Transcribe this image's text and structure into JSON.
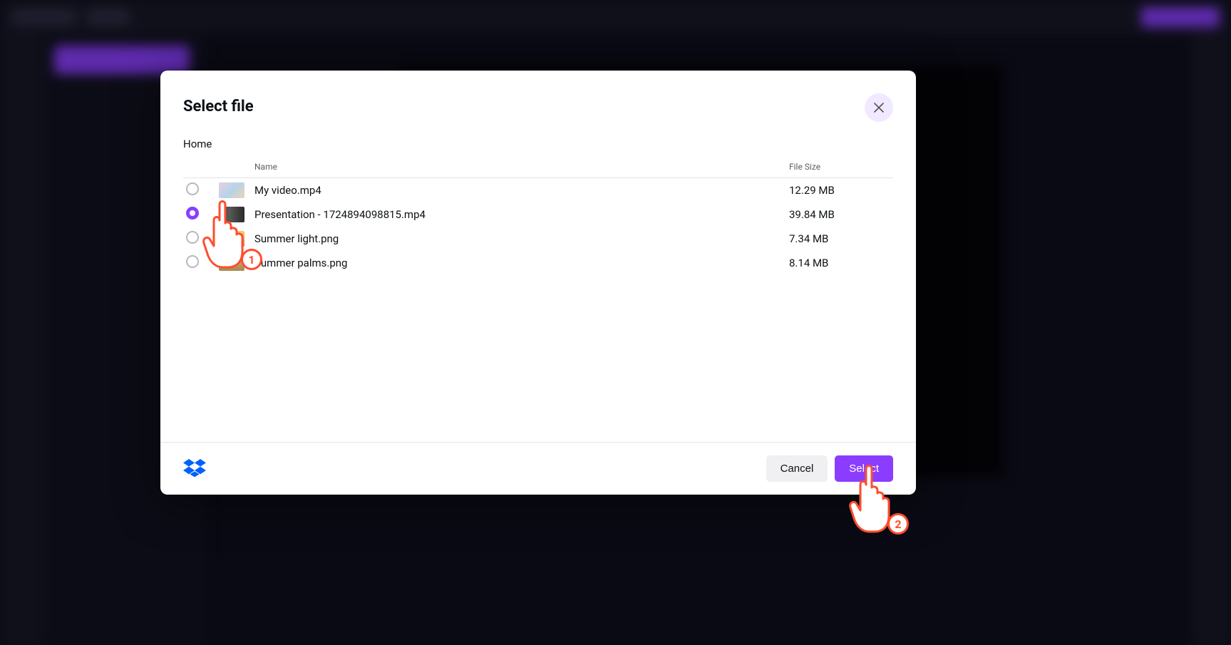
{
  "modal": {
    "title": "Select file",
    "breadcrumb": "Home",
    "columns": {
      "name": "Name",
      "size": "File Size"
    },
    "files": [
      {
        "name": "My video.mp4",
        "size": "12.29 MB",
        "selected": false
      },
      {
        "name": "Presentation - 1724894098815.mp4",
        "size": "39.84 MB",
        "selected": true
      },
      {
        "name": "Summer light.png",
        "size": "7.34 MB",
        "selected": false
      },
      {
        "name": "Summer palms.png",
        "size": "8.14 MB",
        "selected": false
      }
    ],
    "buttons": {
      "cancel": "Cancel",
      "select": "Select"
    }
  },
  "callouts": {
    "step1": "1",
    "step2": "2"
  }
}
